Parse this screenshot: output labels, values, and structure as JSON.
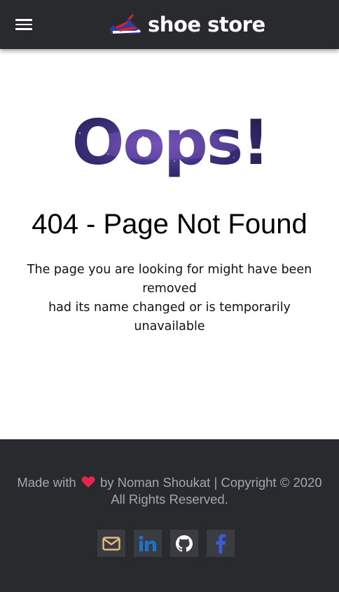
{
  "navbar": {
    "brand_name": "shoe store",
    "icons": {
      "menu": "hamburger-menu-icon",
      "logo": "sneaker-logo-icon"
    },
    "colors": {
      "background": "#282a2e",
      "logo_red": "#e02020",
      "logo_blue": "#2f3c9c"
    }
  },
  "main": {
    "oops_text": "Oops!",
    "title": "404 - Page Not Found",
    "description_line1": "The page you are looking for might have been removed",
    "description_line2": "had its name changed or is temporarily unavailable"
  },
  "footer": {
    "credit_prefix": "Made with",
    "credit_suffix": "by Noman Shoukat | Copyright © 2020 All Rights Reserved.",
    "heart_icon": "heart-icon",
    "heart_color": "#e8264c",
    "socials": [
      {
        "icon": "email-icon",
        "color": "#e9b97e"
      },
      {
        "icon": "linkedin-icon",
        "color": "#1b74c8"
      },
      {
        "icon": "github-icon",
        "color": "#ffffff"
      },
      {
        "icon": "facebook-icon",
        "color": "#3b5bd6"
      }
    ]
  }
}
